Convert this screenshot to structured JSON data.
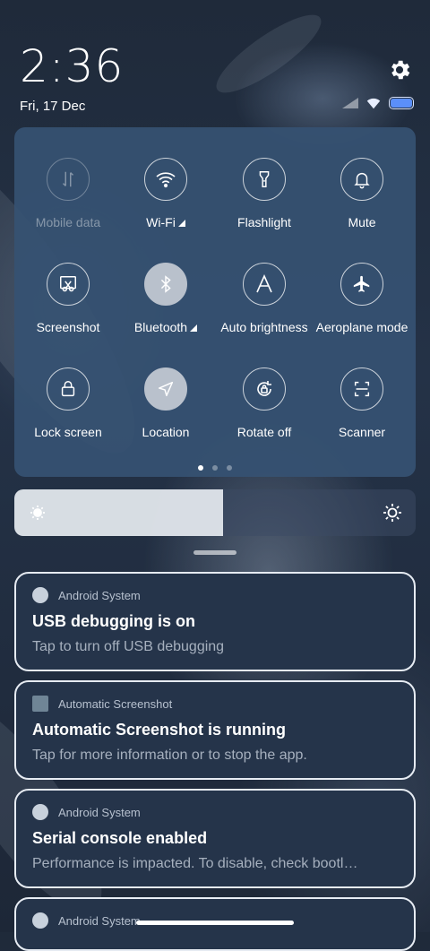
{
  "status": {
    "time": "2:36",
    "date": "Fri, 17 Dec"
  },
  "icons": {
    "settings": "gear-icon",
    "signal": "signal-icon",
    "wifi": "wifi-icon",
    "battery": "battery-icon"
  },
  "quick_settings": [
    {
      "label": "Mobile data",
      "icon": "mobile-data-icon",
      "state": "disabled",
      "has_indicator": false
    },
    {
      "label": "Wi-Fi",
      "icon": "wifi-icon",
      "state": "off",
      "has_indicator": true
    },
    {
      "label": "Flashlight",
      "icon": "flashlight-icon",
      "state": "off",
      "has_indicator": false
    },
    {
      "label": "Mute",
      "icon": "bell-icon",
      "state": "off",
      "has_indicator": false
    },
    {
      "label": "Screenshot",
      "icon": "screenshot-icon",
      "state": "off",
      "has_indicator": false
    },
    {
      "label": "Bluetooth",
      "icon": "bluetooth-icon",
      "state": "on",
      "has_indicator": true
    },
    {
      "label": "Auto brightness",
      "icon": "auto-brightness-icon",
      "state": "off",
      "has_indicator": false
    },
    {
      "label": "Aeroplane mode",
      "icon": "airplane-icon",
      "state": "off",
      "has_indicator": false
    },
    {
      "label": "Lock screen",
      "icon": "lock-icon",
      "state": "off",
      "has_indicator": false
    },
    {
      "label": "Location",
      "icon": "location-icon",
      "state": "on",
      "has_indicator": false
    },
    {
      "label": "Rotate off",
      "icon": "rotate-lock-icon",
      "state": "off",
      "has_indicator": false
    },
    {
      "label": "Scanner",
      "icon": "scanner-icon",
      "state": "off",
      "has_indicator": false
    }
  ],
  "page_indicator": {
    "pages": 3,
    "current": 1
  },
  "brightness": {
    "level": 0.52
  },
  "notifications": [
    {
      "app": "Android System",
      "icon": "android-system-icon",
      "title": "USB debugging is on",
      "text": "Tap to turn off USB debugging"
    },
    {
      "app": "Automatic Screenshot",
      "icon": "automatic-screenshot-icon",
      "title": "Automatic Screenshot is running",
      "text": "Tap for more information or to stop the app."
    },
    {
      "app": "Android System",
      "icon": "android-system-icon",
      "title": "Serial console enabled",
      "text": "Performance is impacted. To disable, check bootl…"
    },
    {
      "app": "Android System",
      "icon": "android-system-icon",
      "title": "",
      "text": ""
    }
  ],
  "colors": {
    "panel": "#365272",
    "tile_on": "#b9c1cc",
    "notification_bg": "#25344a",
    "battery": "#5b8ff9"
  }
}
